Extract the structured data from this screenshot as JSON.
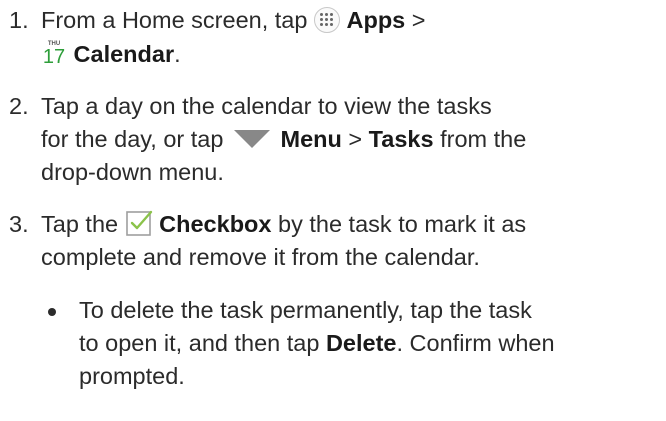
{
  "steps": [
    {
      "number": "1.",
      "lines": [
        {
          "pre": "From a Home screen, tap",
          "bold": "Apps",
          "post": ">"
        },
        {
          "bold": "Calendar",
          "post": "."
        }
      ]
    },
    {
      "number": "2.",
      "lines": [
        {
          "text": "Tap a day on the calendar to view the tasks"
        },
        {
          "pre": "for the day, or tap",
          "bold": "Menu",
          "mid": ">",
          "bold2": "Tasks",
          "post": "from the"
        },
        {
          "text": "drop-down menu."
        }
      ]
    },
    {
      "number": "3.",
      "lines": [
        {
          "pre": "Tap the",
          "bold": "Checkbox",
          "post": "by the task to mark it as"
        },
        {
          "text": "complete and remove it from the calendar."
        }
      ]
    }
  ],
  "bullet": {
    "lines": [
      {
        "text": "To delete the task permanently, tap the task"
      },
      {
        "pre": "to open it, and then tap",
        "bold": "Delete",
        "post": ". Confirm when"
      },
      {
        "text": "prompted."
      }
    ]
  },
  "icons": {
    "apps": "apps-icon",
    "calendar": "calendar-icon",
    "calendar_weekday": "THU",
    "calendar_day": "17",
    "menu": "menu-triangle-icon",
    "checkbox": "checkbox-icon"
  },
  "colors": {
    "text": "#2b2b2b",
    "calendar_day": "#2e9e3a",
    "checkbox": "#8bc34a",
    "menu_triangle": "#888888"
  }
}
